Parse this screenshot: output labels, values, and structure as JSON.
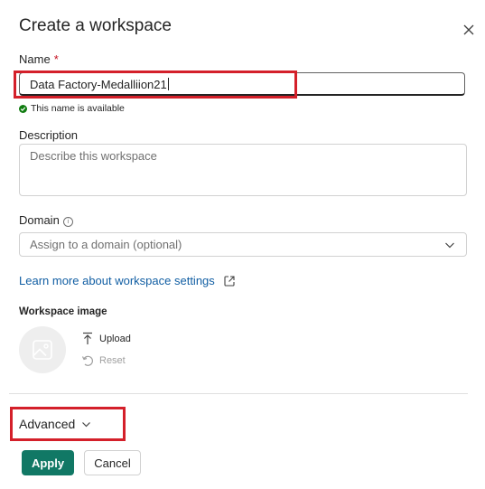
{
  "dialog": {
    "title": "Create a workspace",
    "close_icon": "close-icon"
  },
  "name": {
    "label": "Name",
    "required_mark": "*",
    "value": "Data Factory-Medalliion21",
    "availability": "This name is available"
  },
  "description": {
    "label": "Description",
    "placeholder": "Describe this workspace"
  },
  "domain": {
    "label": "Domain",
    "info_icon": "info-icon",
    "placeholder": "Assign to a domain (optional)"
  },
  "learn_more": {
    "text": "Learn more about workspace settings",
    "icon": "external-link-icon"
  },
  "workspace_image": {
    "label": "Workspace image",
    "upload_label": "Upload",
    "reset_label": "Reset"
  },
  "advanced": {
    "label": "Advanced"
  },
  "footer": {
    "apply_label": "Apply",
    "cancel_label": "Cancel"
  },
  "colors": {
    "primary": "#117865",
    "highlight": "#d4202a",
    "success": "#107c10",
    "link": "#115ea3"
  }
}
